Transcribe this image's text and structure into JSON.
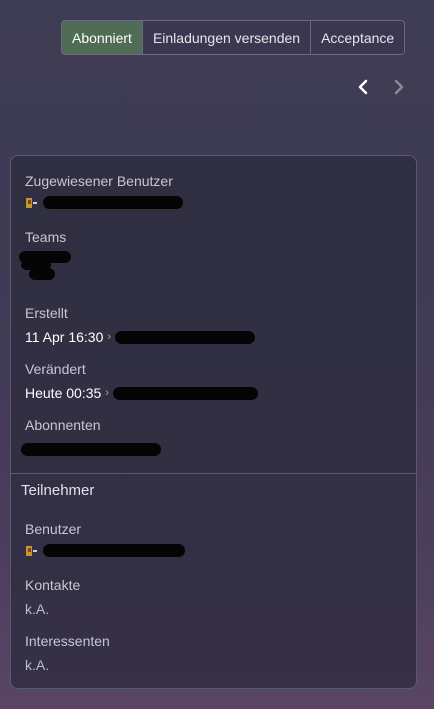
{
  "toolbar": {
    "buttons": [
      {
        "label": "Abonniert",
        "active": true
      },
      {
        "label": "Einladungen versenden",
        "active": false
      },
      {
        "label": "Acceptance",
        "active": false
      }
    ]
  },
  "pager": {
    "prev_icon": "chevron-left-icon",
    "next_icon": "chevron-right-icon"
  },
  "details": {
    "assigned_user": {
      "label": "Zugewiesener Benutzer"
    },
    "teams": {
      "label": "Teams"
    },
    "created": {
      "label": "Erstellt",
      "value": "11 Apr 16:30"
    },
    "modified": {
      "label": "Verändert",
      "value": "Heute 00:35"
    },
    "followers": {
      "label": "Abonnenten"
    }
  },
  "participants": {
    "title": "Teilnehmer",
    "users": {
      "label": "Benutzer"
    },
    "contacts": {
      "label": "Kontakte",
      "value": "k.A."
    },
    "leads": {
      "label": "Interessenten",
      "value": "k.A."
    }
  },
  "colors": {
    "active_button": "#4f6d55",
    "panel_bg": "#2d2b3e"
  }
}
